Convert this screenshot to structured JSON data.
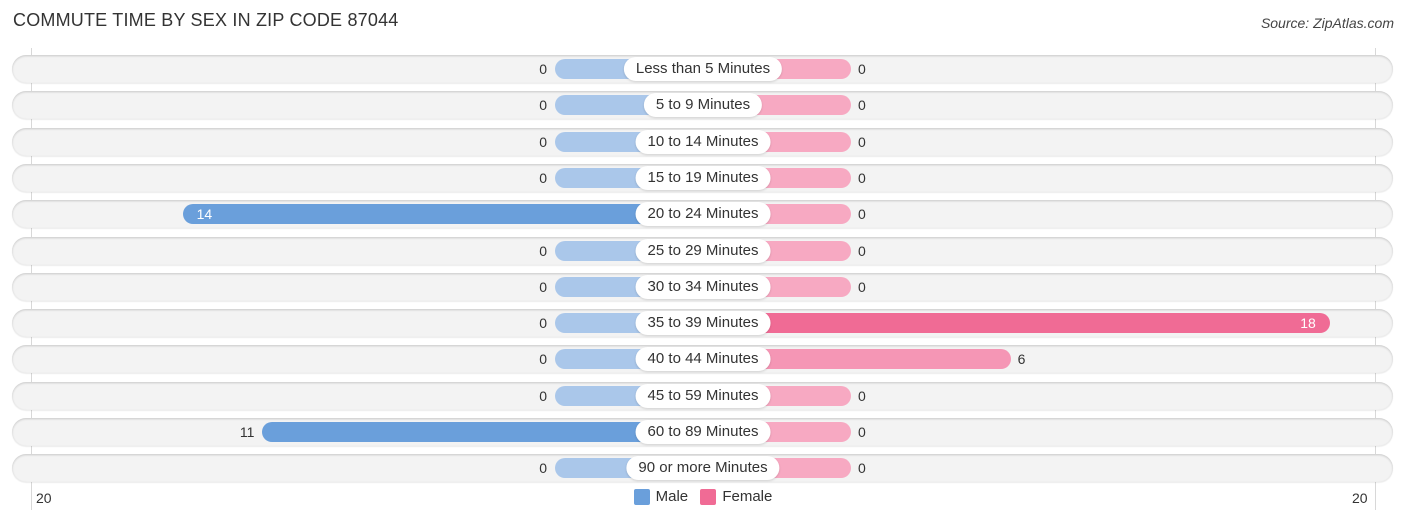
{
  "chart_data": {
    "type": "bar",
    "orientation": "horizontal-diverging",
    "title": "COMMUTE TIME BY SEX IN ZIP CODE 87044",
    "source": "Source: ZipAtlas.com",
    "categories": [
      "Less than 5 Minutes",
      "5 to 9 Minutes",
      "10 to 14 Minutes",
      "15 to 19 Minutes",
      "20 to 24 Minutes",
      "25 to 29 Minutes",
      "30 to 34 Minutes",
      "35 to 39 Minutes",
      "40 to 44 Minutes",
      "45 to 59 Minutes",
      "60 to 89 Minutes",
      "90 or more Minutes"
    ],
    "series": [
      {
        "name": "Male",
        "color": "#6a9fdb",
        "values": [
          0,
          0,
          0,
          0,
          14,
          0,
          0,
          0,
          0,
          0,
          11,
          0
        ]
      },
      {
        "name": "Female",
        "color": "#f06b95",
        "values": [
          0,
          0,
          0,
          0,
          0,
          0,
          0,
          18,
          6,
          0,
          0,
          0
        ]
      }
    ],
    "axis": {
      "left_tick": "20",
      "right_tick": "20",
      "range": [
        20,
        20
      ]
    },
    "legend": {
      "position": "bottom-center",
      "entries": [
        "Male",
        "Female"
      ]
    },
    "grid": false
  }
}
